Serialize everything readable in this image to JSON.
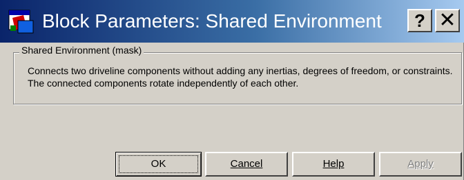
{
  "window": {
    "title": "Block Parameters: Shared Environment",
    "help_button": "?",
    "close_button": "✕"
  },
  "group": {
    "title": "Shared Environment (mask)",
    "description": "Connects two driveline components without adding any inertias, degrees of freedom, or constraints. The connected components rotate independently of each other."
  },
  "buttons": {
    "ok": "OK",
    "cancel": "Cancel",
    "help": "Help",
    "apply": "Apply"
  },
  "colors": {
    "titlebar_start": "#0a246a",
    "titlebar_end": "#a6caf0",
    "face": "#d4d0c8",
    "disabled_text": "#808080"
  }
}
